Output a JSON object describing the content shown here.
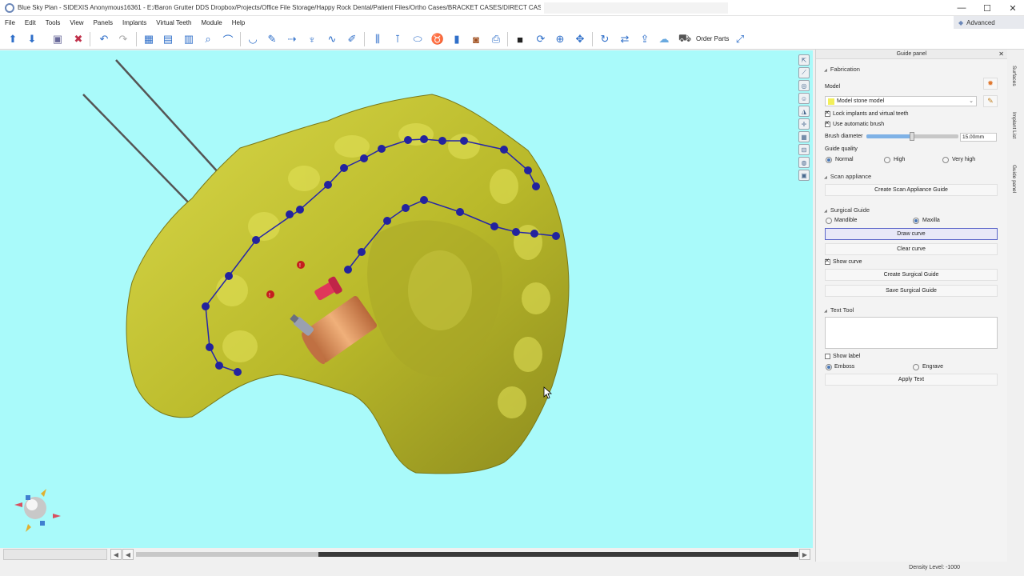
{
  "window": {
    "title": "Blue Sky Plan - SIDEXIS Anonymous16361 - E:/Baron Grutter DDS Dropbox/Projects/Office File Storage/Happy Rock Dental/Patient Files/Ortho Cases/BRACKET CASES/DIRECT CASES/N",
    "minimize": "—",
    "maximize": "☐",
    "close": "✕"
  },
  "menu": [
    "File",
    "Edit",
    "Tools",
    "View",
    "Panels",
    "Implants",
    "Virtual Teeth",
    "Module",
    "Help"
  ],
  "mode": {
    "label": "Advanced"
  },
  "toolbar": {
    "order_parts": "Order Parts"
  },
  "status": {
    "density": "Density Level: -1000"
  },
  "guide_panel": {
    "title": "Guide panel",
    "fabrication": {
      "title": "Fabrication",
      "model_label": "Model",
      "model_value": "Model stone model",
      "lock_label": "Lock implants and virtual teeth",
      "lock_checked": true,
      "auto_brush_label": "Use automatic brush",
      "auto_brush_checked": true,
      "brush_diameter_label": "Brush diameter",
      "brush_diameter_value": "15.00mm",
      "guide_quality_label": "Guide quality",
      "quality_options": [
        "Normal",
        "High",
        "Very high"
      ],
      "quality_selected": "Normal"
    },
    "scan_appliance": {
      "title": "Scan appliance",
      "create_button": "Create Scan Appliance Guide"
    },
    "surgical_guide": {
      "title": "Surgical Guide",
      "mandible_label": "Mandible",
      "maxilla_label": "Maxilla",
      "arch_selected": "Maxilla",
      "draw_curve": "Draw curve",
      "clear_curve": "Clear curve",
      "show_curve_label": "Show curve",
      "show_curve_checked": true,
      "create_button": "Create Surgical Guide",
      "save_button": "Save Surgical Guide"
    },
    "text_tool": {
      "title": "Text Tool",
      "text_value": "",
      "show_label": "Show label",
      "show_label_checked": false,
      "emboss_label": "Emboss",
      "engrave_label": "Engrave",
      "mode_selected": "Emboss",
      "apply_button": "Apply Text"
    }
  },
  "side_tabs": [
    "Surfaces",
    "Implant List",
    "Guide panel"
  ],
  "colors": {
    "viewport_bg": "#a9fafa",
    "model": "#c8c832",
    "curve": "#2626a8",
    "implant": "#d98a50",
    "accent": "#5b66c9"
  }
}
